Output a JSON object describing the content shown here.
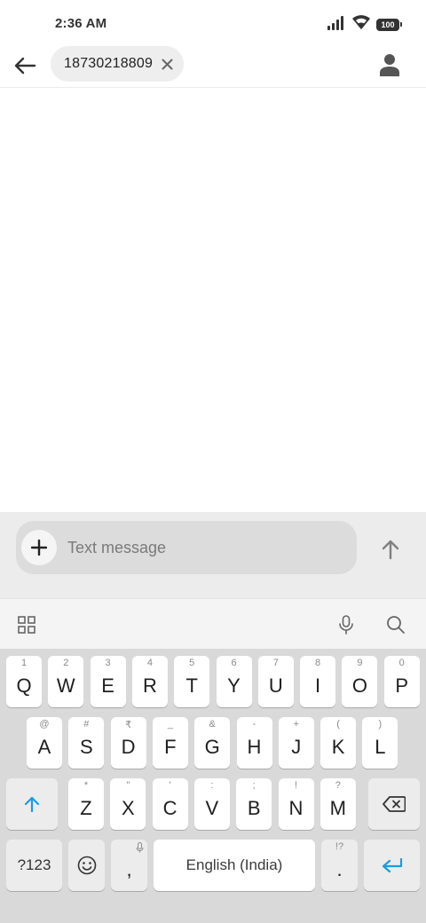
{
  "status_bar": {
    "time": "2:36 AM",
    "battery": "100",
    "icons": [
      "signal-icon",
      "wifi-icon",
      "battery-icon"
    ]
  },
  "app_bar": {
    "recipient": "18730218809",
    "icons": [
      "back-arrow-icon",
      "close-icon",
      "person-icon"
    ]
  },
  "compose": {
    "placeholder": "Text message",
    "icons": [
      "plus-icon",
      "send-arrow-icon"
    ]
  },
  "keyboard_toolbar": {
    "icons": [
      "grid-icon",
      "microphone-icon",
      "search-icon"
    ]
  },
  "keyboard": {
    "row1": [
      {
        "label": "Q",
        "hint": "1"
      },
      {
        "label": "W",
        "hint": "2"
      },
      {
        "label": "E",
        "hint": "3"
      },
      {
        "label": "R",
        "hint": "4"
      },
      {
        "label": "T",
        "hint": "5"
      },
      {
        "label": "Y",
        "hint": "6"
      },
      {
        "label": "U",
        "hint": "7"
      },
      {
        "label": "I",
        "hint": "8"
      },
      {
        "label": "O",
        "hint": "9"
      },
      {
        "label": "P",
        "hint": "0"
      }
    ],
    "row2": [
      {
        "label": "A",
        "hint": "@"
      },
      {
        "label": "S",
        "hint": "#"
      },
      {
        "label": "D",
        "hint": "₹"
      },
      {
        "label": "F",
        "hint": "_"
      },
      {
        "label": "G",
        "hint": "&"
      },
      {
        "label": "H",
        "hint": "-"
      },
      {
        "label": "J",
        "hint": "+"
      },
      {
        "label": "K",
        "hint": "("
      },
      {
        "label": "L",
        "hint": ")"
      }
    ],
    "row3": [
      {
        "label": "Z",
        "hint": "*"
      },
      {
        "label": "X",
        "hint": "\""
      },
      {
        "label": "C",
        "hint": "'"
      },
      {
        "label": "V",
        "hint": ":"
      },
      {
        "label": "B",
        "hint": ";"
      },
      {
        "label": "N",
        "hint": "!"
      },
      {
        "label": "M",
        "hint": "?"
      }
    ],
    "symbols_label": "?123",
    "comma_label": ",",
    "space_label": "English (India)",
    "period_label": ".",
    "period_hint": "!?",
    "accent_color": "#1a9be6",
    "special_icons": [
      "shift-icon",
      "backspace-icon",
      "emoji-icon",
      "enter-icon",
      "mic-small-icon"
    ]
  }
}
